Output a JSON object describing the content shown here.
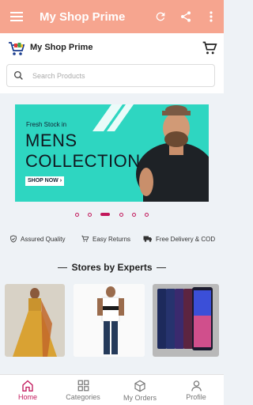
{
  "appbar": {
    "title": "My Shop Prime",
    "icons": [
      "hamburger-menu-icon",
      "refresh-icon",
      "share-icon",
      "more-vert-icon"
    ],
    "bg_color": "#f6a58f"
  },
  "store": {
    "name": "My Shop Prime",
    "logo_icon": "shopping-cart-logo",
    "cart_icon": "cart-icon"
  },
  "search": {
    "placeholder": "Search Products",
    "value": ""
  },
  "banner": {
    "line1": "Fresh Stock in",
    "line2": "MENS",
    "line3": "COLLECTION",
    "cta": "SHOP NOW",
    "bg_color": "#2ed6c1"
  },
  "carousel": {
    "slide_count": 6,
    "active_index": 2,
    "accent": "#c2185b"
  },
  "features": [
    {
      "label": "Assured Quality",
      "icon": "shield-check-icon"
    },
    {
      "label": "Easy Returns",
      "icon": "cart-return-icon"
    },
    {
      "label": "Free Delivery & COD",
      "icon": "truck-icon"
    }
  ],
  "section": {
    "title": "Stores by Experts"
  },
  "stores": [
    {
      "name": "ethnic-wear",
      "icon": "woman-lehenga-image"
    },
    {
      "name": "mens-fashion",
      "icon": "man-striped-tshirt-image"
    },
    {
      "name": "mobiles",
      "icon": "smartphones-image"
    }
  ],
  "bottom_nav": [
    {
      "label": "Home",
      "icon": "home-icon",
      "active": true
    },
    {
      "label": "Categories",
      "icon": "grid-icon",
      "active": false
    },
    {
      "label": "My Orders",
      "icon": "box-icon",
      "active": false
    },
    {
      "label": "Profile",
      "icon": "person-icon",
      "active": false
    }
  ]
}
